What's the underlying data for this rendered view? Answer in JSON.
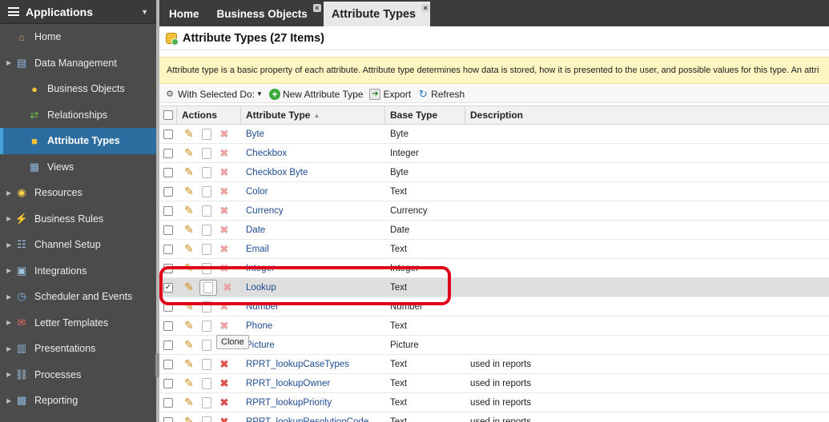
{
  "sidebar": {
    "title": "Applications",
    "items": [
      {
        "label": "Home",
        "level": 0,
        "arrow": false,
        "icon": "home-icon"
      },
      {
        "label": "Data Management",
        "level": 0,
        "arrow": true,
        "icon": "database-icon"
      },
      {
        "label": "Business Objects",
        "level": 1,
        "arrow": false,
        "icon": "cylinder-icon"
      },
      {
        "label": "Relationships",
        "level": 1,
        "arrow": false,
        "icon": "relationship-icon"
      },
      {
        "label": "Attribute Types",
        "level": 1,
        "arrow": false,
        "icon": "attribute-icon",
        "active": true
      },
      {
        "label": "Views",
        "level": 1,
        "arrow": false,
        "icon": "views-icon"
      },
      {
        "label": "Resources",
        "level": 0,
        "arrow": true,
        "icon": "lightbulb-icon"
      },
      {
        "label": "Business Rules",
        "level": 0,
        "arrow": true,
        "icon": "lightning-icon"
      },
      {
        "label": "Channel Setup",
        "level": 0,
        "arrow": true,
        "icon": "channel-icon"
      },
      {
        "label": "Integrations",
        "level": 0,
        "arrow": true,
        "icon": "integrations-icon"
      },
      {
        "label": "Scheduler and Events",
        "level": 0,
        "arrow": true,
        "icon": "clock-icon"
      },
      {
        "label": "Letter Templates",
        "level": 0,
        "arrow": true,
        "icon": "letter-icon"
      },
      {
        "label": "Presentations",
        "level": 0,
        "arrow": true,
        "icon": "presentation-icon"
      },
      {
        "label": "Processes",
        "level": 0,
        "arrow": true,
        "icon": "process-icon"
      },
      {
        "label": "Reporting",
        "level": 0,
        "arrow": true,
        "icon": "report-icon"
      }
    ]
  },
  "tabs": [
    {
      "label": "Home",
      "closable": false,
      "active": false
    },
    {
      "label": "Business Objects",
      "closable": true,
      "active": false
    },
    {
      "label": "Attribute Types",
      "closable": true,
      "active": true
    }
  ],
  "page": {
    "title": "Attribute Types (27 Items)",
    "info": "Attribute type is a basic property of each attribute. Attribute type determines how data is stored, how it is presented to the user, and possible values for this type. An attri"
  },
  "toolbar": {
    "with_selected": "With Selected Do:",
    "new": "New Attribute Type",
    "export": "Export",
    "refresh": "Refresh"
  },
  "grid": {
    "headers": {
      "actions": "Actions",
      "attribute_type": "Attribute Type",
      "base_type": "Base Type",
      "description": "Description"
    },
    "rows": [
      {
        "name": "Byte",
        "base": "Byte",
        "desc": "",
        "checked": false,
        "deletable": false
      },
      {
        "name": "Checkbox",
        "base": "Integer",
        "desc": "",
        "checked": false,
        "deletable": false
      },
      {
        "name": "Checkbox Byte",
        "base": "Byte",
        "desc": "",
        "checked": false,
        "deletable": false
      },
      {
        "name": "Color",
        "base": "Text",
        "desc": "",
        "checked": false,
        "deletable": false
      },
      {
        "name": "Currency",
        "base": "Currency",
        "desc": "",
        "checked": false,
        "deletable": false
      },
      {
        "name": "Date",
        "base": "Date",
        "desc": "",
        "checked": false,
        "deletable": false
      },
      {
        "name": "Email",
        "base": "Text",
        "desc": "",
        "checked": false,
        "deletable": false
      },
      {
        "name": "Integer",
        "base": "Integer",
        "desc": "",
        "checked": false,
        "deletable": false
      },
      {
        "name": "Lookup",
        "base": "Text",
        "desc": "",
        "checked": true,
        "deletable": false
      },
      {
        "name": "Number",
        "base": "Number",
        "desc": "",
        "checked": false,
        "deletable": false
      },
      {
        "name": "Phone",
        "base": "Text",
        "desc": "",
        "checked": false,
        "deletable": false
      },
      {
        "name": "Picture",
        "base": "Picture",
        "desc": "",
        "checked": false,
        "deletable": false
      },
      {
        "name": "RPRT_lookupCaseTypes",
        "base": "Text",
        "desc": "used in reports",
        "checked": false,
        "deletable": true
      },
      {
        "name": "RPRT_lookupOwner",
        "base": "Text",
        "desc": "used in reports",
        "checked": false,
        "deletable": true
      },
      {
        "name": "RPRT_lookupPriority",
        "base": "Text",
        "desc": "used in reports",
        "checked": false,
        "deletable": true
      },
      {
        "name": "RPRT_lookupResolutionCode",
        "base": "Text",
        "desc": "used in reports",
        "checked": false,
        "deletable": true
      }
    ]
  },
  "tooltip": "Clone",
  "colors": {
    "sidebar_bg": "#4b4b4b",
    "active_nav": "#2b6d9e",
    "highlight": "#e0001a",
    "info_bg": "#fdf6c3"
  }
}
